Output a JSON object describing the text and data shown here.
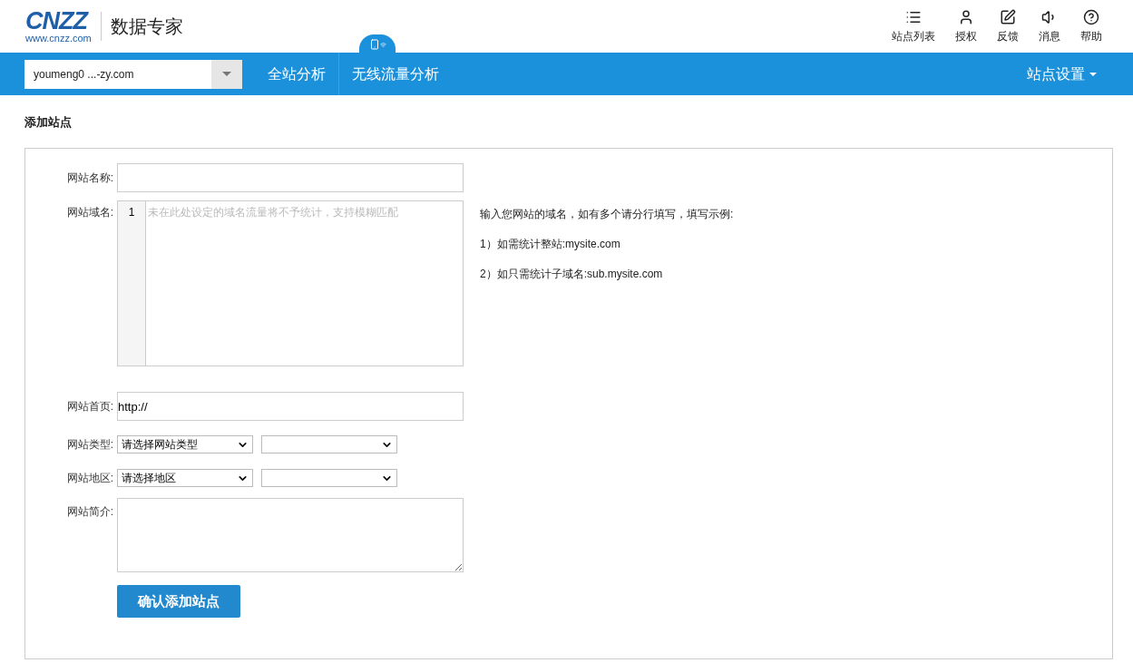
{
  "header": {
    "logo": {
      "text": "CNZZ",
      "url": "www.cnzz.com"
    },
    "product": "数据专家",
    "tools": [
      {
        "label": "站点列表"
      },
      {
        "label": "授权"
      },
      {
        "label": "反馈"
      },
      {
        "label": "消息"
      },
      {
        "label": "帮助"
      }
    ]
  },
  "navbar": {
    "site_select": "youmeng0 ...-zy.com",
    "items": [
      {
        "label": "全站分析",
        "mobile_badge": false
      },
      {
        "label": "无线流量分析",
        "mobile_badge": true
      }
    ],
    "settings": "站点设置"
  },
  "page_title": "添加站点",
  "form": {
    "rows": [
      {
        "kind": "text",
        "label": "网站名称:",
        "value": ""
      },
      {
        "kind": "code",
        "label": "网站域名:",
        "line_number": "1",
        "placeholder": "未在此处设定的域名流量将不予统计，支持模糊匹配",
        "help": [
          "输入您网站的域名，如有多个请分行填写，填写示例:",
          "1）如需统计整站:mysite.com",
          "2）如只需统计子域名:sub.mysite.com"
        ]
      },
      {
        "kind": "text",
        "label": "网站首页:",
        "value": "http://"
      },
      {
        "kind": "selects",
        "label": "网站类型:",
        "value": "请选择网站类型"
      },
      {
        "kind": "selects",
        "label": "网站地区:",
        "value": "请选择地区"
      },
      {
        "kind": "textarea",
        "label": "网站简介:",
        "value": ""
      }
    ],
    "submit": "确认添加站点"
  }
}
